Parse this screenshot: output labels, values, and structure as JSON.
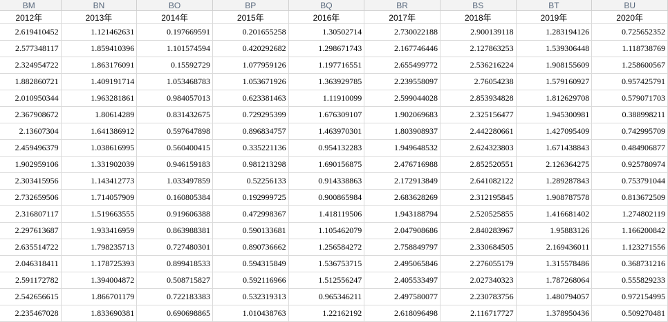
{
  "columns": [
    "BM",
    "BN",
    "BO",
    "BP",
    "BQ",
    "BR",
    "BS",
    "BT",
    "BU"
  ],
  "years": [
    "2012年",
    "2013年",
    "2014年",
    "2015年",
    "2016年",
    "2017年",
    "2018年",
    "2019年",
    "2020年"
  ],
  "rows": [
    [
      "2.619410452",
      "1.121462631",
      "0.197669591",
      "0.201655258",
      "1.30502714",
      "2.730022188",
      "2.900139118",
      "1.283194126",
      "0.725652352"
    ],
    [
      "2.577348117",
      "1.859410396",
      "1.101574594",
      "0.420292682",
      "1.298671743",
      "2.167746446",
      "2.127863253",
      "1.539306448",
      "1.118738769"
    ],
    [
      "2.324954722",
      "1.863176091",
      "0.15592729",
      "1.077959126",
      "1.197716551",
      "2.655499772",
      "2.536216224",
      "1.908155609",
      "1.258600567"
    ],
    [
      "1.882860721",
      "1.409191714",
      "1.053468783",
      "1.053671926",
      "1.363929785",
      "2.239558097",
      "2.76054238",
      "1.579160927",
      "0.957425791"
    ],
    [
      "2.010950344",
      "1.963281861",
      "0.984057013",
      "0.623381463",
      "1.11910099",
      "2.599044028",
      "2.853934828",
      "1.812629708",
      "0.579071703"
    ],
    [
      "2.367908672",
      "1.80614289",
      "0.831432675",
      "0.729295399",
      "1.676309107",
      "1.902069683",
      "2.325156477",
      "1.945300981",
      "0.388998211"
    ],
    [
      "2.13607304",
      "1.641386912",
      "0.597647898",
      "0.896834757",
      "1.463970301",
      "1.803908937",
      "2.442280661",
      "1.427095409",
      "0.742995709"
    ],
    [
      "2.459496379",
      "1.038616995",
      "0.560400415",
      "0.335221136",
      "0.954132283",
      "1.949648532",
      "2.624323803",
      "1.671438843",
      "0.484906877"
    ],
    [
      "1.902959106",
      "1.331902039",
      "0.946159183",
      "0.981213298",
      "1.690156875",
      "2.476716988",
      "2.852520551",
      "2.126364275",
      "0.925780974"
    ],
    [
      "2.303415956",
      "1.143412773",
      "1.033497859",
      "0.52256133",
      "0.914338863",
      "2.172913849",
      "2.641082122",
      "1.289287843",
      "0.753791044"
    ],
    [
      "2.732659506",
      "1.714057909",
      "0.160805384",
      "0.192999725",
      "0.900865984",
      "2.683628269",
      "2.312195845",
      "1.908787578",
      "0.813672509"
    ],
    [
      "2.316807117",
      "1.519663555",
      "0.919606388",
      "0.472998367",
      "1.418119506",
      "1.943188794",
      "2.520525855",
      "1.416681402",
      "1.274802119"
    ],
    [
      "2.297613687",
      "1.933416959",
      "0.863988381",
      "0.590133681",
      "1.105462079",
      "2.047908686",
      "2.840283967",
      "1.95883126",
      "1.166200842"
    ],
    [
      "2.635514722",
      "1.798235713",
      "0.727480301",
      "0.890736662",
      "1.256584272",
      "2.758849797",
      "2.330684505",
      "2.169436011",
      "1.123271556"
    ],
    [
      "2.046318411",
      "1.178725393",
      "0.899418533",
      "0.594315849",
      "1.536753715",
      "2.495065846",
      "2.276055179",
      "1.315578486",
      "0.368731216"
    ],
    [
      "2.591172782",
      "1.394004872",
      "0.508715827",
      "0.592116966",
      "1.512556247",
      "2.405533497",
      "2.027340323",
      "1.787268064",
      "0.555829233"
    ],
    [
      "2.542656615",
      "1.866701179",
      "0.722183383",
      "0.532319313",
      "0.965346211",
      "2.497580077",
      "2.230783756",
      "1.480794057",
      "0.972154995"
    ],
    [
      "2.235467028",
      "1.833690381",
      "0.690698865",
      "1.010438763",
      "1.22162192",
      "2.618096498",
      "2.116717727",
      "1.378950436",
      "0.509270481"
    ]
  ]
}
